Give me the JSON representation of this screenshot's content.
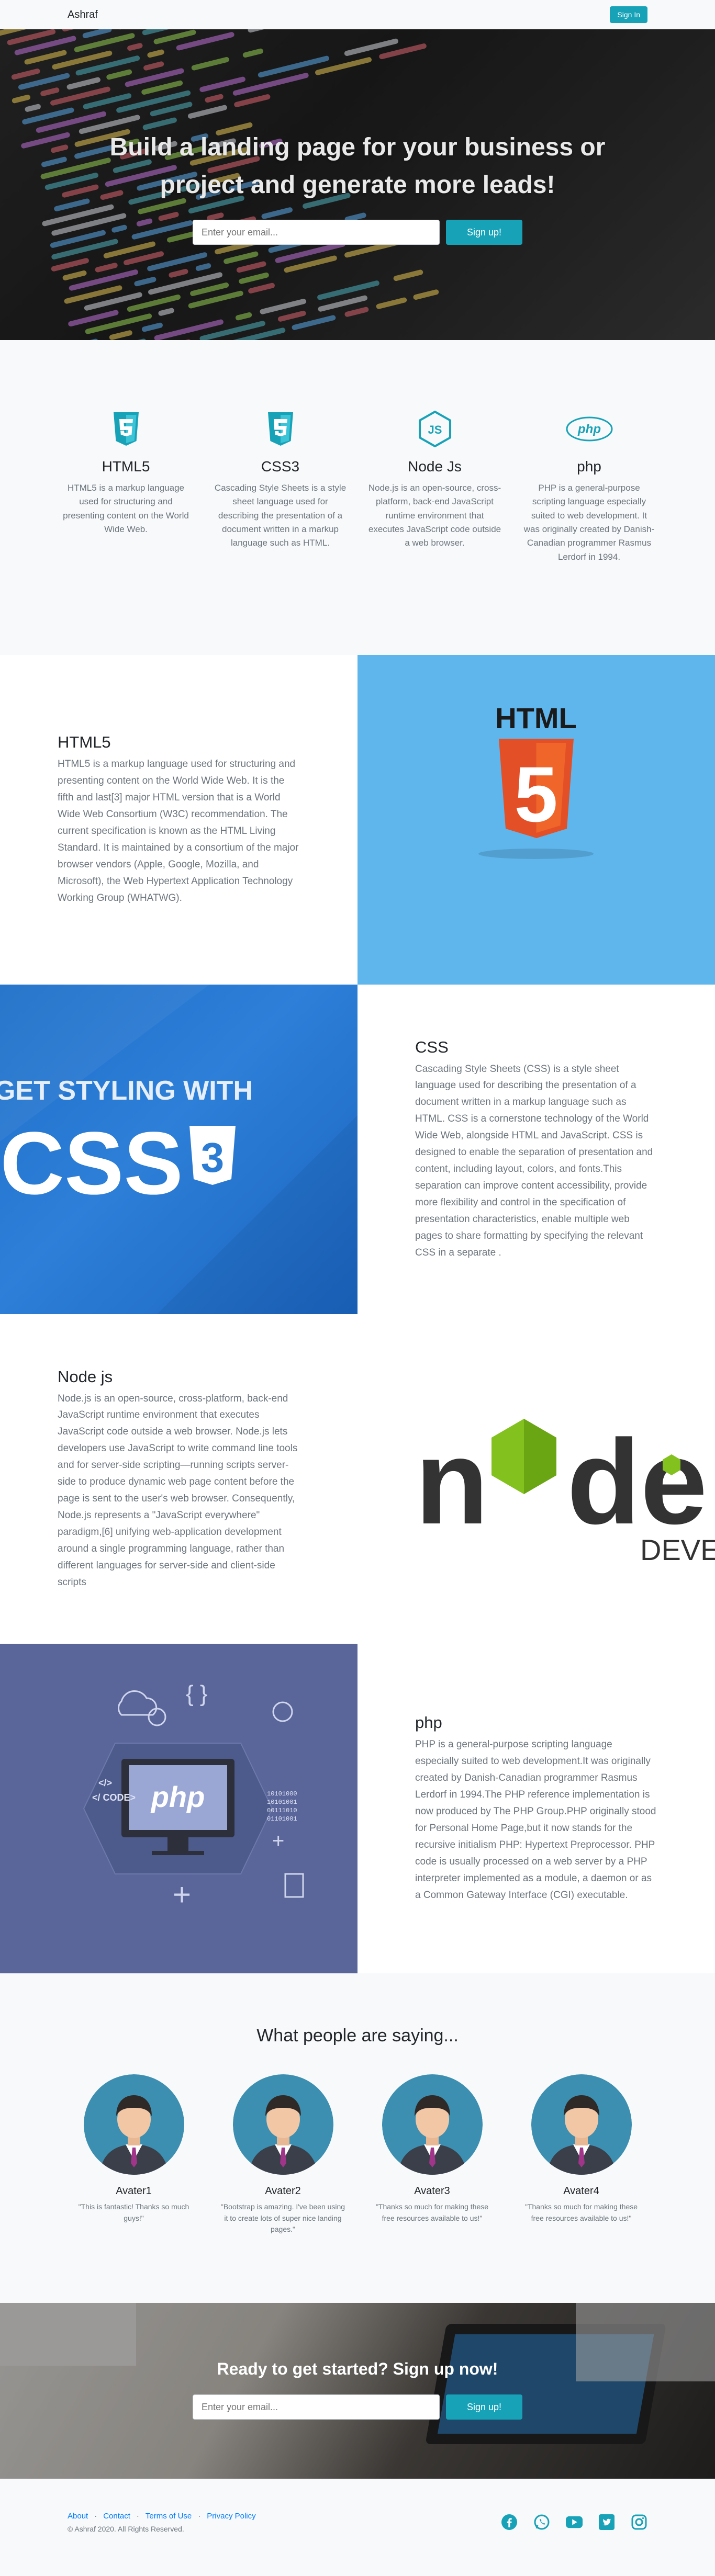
{
  "navbar": {
    "brand": "Ashraf",
    "signin_label": "Sign In"
  },
  "hero": {
    "title": "Build a landing page for your business or project and generate more leads!",
    "email_placeholder": "Enter your email...",
    "signup_label": "Sign up!"
  },
  "features": [
    {
      "title": "HTML5",
      "text": "HTML5 is a markup language used for structuring and presenting content on the World Wide Web.",
      "icon": "html5-icon"
    },
    {
      "title": "CSS3",
      "text": "Cascading Style Sheets is a style sheet language used for describing the presentation of a document written in a markup language such as HTML.",
      "icon": "css3-icon"
    },
    {
      "title": "Node Js",
      "text": "Node.js is an open-source, cross-platform, back-end JavaScript runtime environment that executes JavaScript code outside a web browser.",
      "icon": "nodejs-icon"
    },
    {
      "title": "php",
      "text": "PHP is a general-purpose scripting language especially suited to web development. It was originally created by Danish-Canadian programmer Rasmus Lerdorf in 1994.",
      "icon": "php-icon"
    }
  ],
  "showcase": {
    "html": {
      "title": "HTML5",
      "text": "HTML5 is a markup language used for structuring and presenting content on the World Wide Web. It is the fifth and last[3] major HTML version that is a World Wide Web Consortium (W3C) recommendation. The current specification is known as the HTML Living Standard. It is maintained by a consortium of the major browser vendors (Apple, Google, Mozilla, and Microsoft), the Web Hypertext Application Technology Working Group (WHATWG).",
      "logo_text": "HTML",
      "logo_number": "5"
    },
    "css": {
      "title": "CSS",
      "text": "Cascading Style Sheets (CSS) is a style sheet language used for describing the presentation of a document written in a markup language such as HTML. CSS is a cornerstone technology of the World Wide Web, alongside HTML and JavaScript. CSS is designed to enable the separation of presentation and content, including layout, colors, and fonts.This separation can improve content accessibility, provide more flexibility and control in the specification of presentation characteristics, enable multiple web pages to share formatting by specifying the relevant CSS in a separate .",
      "banner_line1": "GET STYLING WITH",
      "banner_line2": "CSS",
      "banner_number": "3"
    },
    "node": {
      "title": "Node js",
      "text": "Node.js is an open-source, cross-platform, back-end JavaScript runtime environment that executes JavaScript code outside a web browser. Node.js lets developers use JavaScript to write command line tools and for server-side scripting—running scripts server-side to produce dynamic web page content before the page is sent to the user's web browser. Consequently, Node.js represents a \"JavaScript everywhere\" paradigm,[6] unifying web-application development around a single programming language, rather than different languages for server-side and client-side scripts",
      "logo_word_start": "n",
      "logo_word_end": "de",
      "logo_subtext": "DEVEL"
    },
    "php": {
      "title": "php",
      "text": "PHP is a general-purpose scripting language especially suited to web development.It was originally created by Danish-Canadian programmer Rasmus Lerdorf in 1994.The PHP reference implementation is now produced by The PHP Group.PHP originally stood for Personal Home Page,but it now stands for the recursive initialism PHP: Hypertext Preprocessor. PHP code is usually processed on a web server by a PHP interpreter implemented as a module, a daemon or as a Common Gateway Interface (CGI) executable.",
      "screen_text": "php",
      "code_tag1": "</>",
      "code_tag2": "</ CODE>",
      "binary": "10101000\n10101001\n00111010\n01101001"
    }
  },
  "testimonials": {
    "heading": "What people are saying...",
    "items": [
      {
        "name": "Avater1",
        "quote": "\"This is fantastic! Thanks so much guys!\""
      },
      {
        "name": "Avater2",
        "quote": "\"Bootstrap is amazing. I've been using it to create lots of super nice landing pages.\""
      },
      {
        "name": "Avater3",
        "quote": "\"Thanks so much for making these free resources available to us!\""
      },
      {
        "name": "Avater4",
        "quote": "\"Thanks so much for making these free resources available to us!\""
      }
    ]
  },
  "cta": {
    "title": "Ready to get started? Sign up now!",
    "email_placeholder": "Enter your email...",
    "signup_label": "Sign up!"
  },
  "footer": {
    "links": [
      "About",
      "Contact",
      "Terms of Use",
      "Privacy Policy"
    ],
    "separator": "·",
    "copyright": "© Ashraf 2020. All Rights Reserved.",
    "social_icons": [
      "facebook-icon",
      "whatsapp-icon",
      "youtube-icon",
      "twitter-icon",
      "instagram-icon"
    ]
  },
  "colors": {
    "accent": "#17a2b8",
    "link": "#007bff",
    "social": "#17a2b8"
  }
}
